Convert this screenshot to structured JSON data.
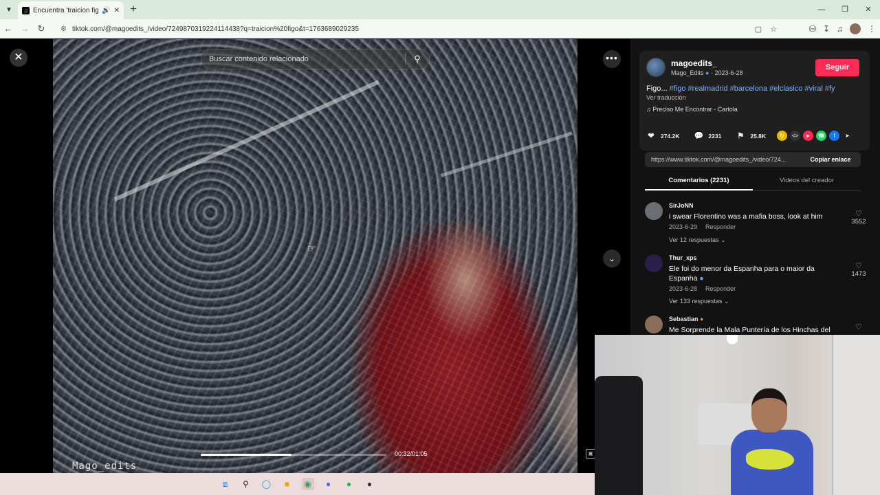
{
  "browser": {
    "tab_title": "Encuentra 'traicion figo' en",
    "tab_audio_icon": "speaker-icon",
    "url": "tiktok.com/@magoedits_/video/7249870319224114438?q=traicion%20figo&t=1763689029235"
  },
  "video": {
    "search_placeholder": "Buscar contenido relacionado",
    "watermark": "Mago_edits",
    "time": "00:32/01:05",
    "progress": 0.49
  },
  "author": {
    "username": "magoedits_",
    "nickname": "Mago_Edits",
    "date": "2023-6-28",
    "follow_label": "Seguir"
  },
  "post": {
    "desc_prefix": "Figo... ",
    "hashtags": "#figo #realmadrid #barcelona #elclasico #viral #fy",
    "translate": "Ver traducción",
    "music": "Preciso Me Encontrar - Cartola"
  },
  "stats": {
    "likes": "274.2K",
    "comments": "2231",
    "saves": "25.8K"
  },
  "share": {
    "link": "https://www.tiktok.com/@magoedits_/video/724...",
    "copy_label": "Copiar enlace"
  },
  "tabs": {
    "comments": "Comentarios (2231)",
    "creator_videos": "Videos del creador"
  },
  "comments": [
    {
      "user": "SirJoNN",
      "text": "i swear Florentino was a mafia boss, look at him",
      "date": "2023-6-29",
      "reply": "Responder",
      "replies": "Ver 12 respuestas",
      "likes": "3552"
    },
    {
      "user": "Thur_xps",
      "text": "Ele foi do menor da Espanha para o maior da Espanha",
      "date": "2023-6-28",
      "reply": "Responder",
      "replies": "Ver 133 respuestas",
      "likes": "1473"
    },
    {
      "user": "Sebastian",
      "text": "Me Sorprende la Mala Puntería de los Hinchas del",
      "date": "",
      "reply": "",
      "replies": "",
      "likes": ""
    }
  ],
  "colors": {
    "follow": "#fe2c55",
    "hashtag": "#7fb2ff",
    "panel_bg": "#121212"
  }
}
